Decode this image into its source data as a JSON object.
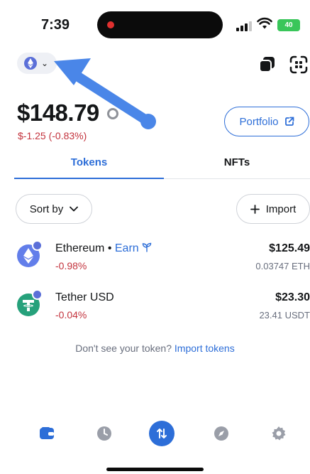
{
  "status_bar": {
    "time": "7:39",
    "battery": "40"
  },
  "header": {
    "network_icon": "ethereum-icon",
    "network_chevron": "⌄"
  },
  "balance": {
    "total": "$148.79",
    "change": "$-1.25 (-0.83%)",
    "portfolio_label": "Portfolio"
  },
  "tabs": [
    {
      "label": "Tokens",
      "active": true
    },
    {
      "label": "NFTs",
      "active": false
    }
  ],
  "controls": {
    "sort_label": "Sort by",
    "import_label": "Import"
  },
  "tokens": [
    {
      "name": "Ethereum",
      "separator": " • ",
      "earn": "Earn",
      "change": "-0.98%",
      "value": "$125.49",
      "amount": "0.03747 ETH",
      "icon": "ethereum-icon"
    },
    {
      "name": "Tether USD",
      "change": "-0.04%",
      "value": "$23.30",
      "amount": "23.41 USDT",
      "icon": "tether-icon"
    }
  ],
  "footer": {
    "prompt": "Don't see your token? ",
    "link": "Import tokens"
  },
  "colors": {
    "accent": "#2d6ed8",
    "negative": "#c3333d",
    "annotation_arrow": "#4a86e8",
    "battery": "#39c65a"
  },
  "nav": [
    {
      "icon": "wallet-icon",
      "active": true
    },
    {
      "icon": "clock-icon",
      "active": false
    },
    {
      "icon": "swap-icon",
      "active": false
    },
    {
      "icon": "compass-icon",
      "active": false
    },
    {
      "icon": "gear-icon",
      "active": false
    }
  ]
}
